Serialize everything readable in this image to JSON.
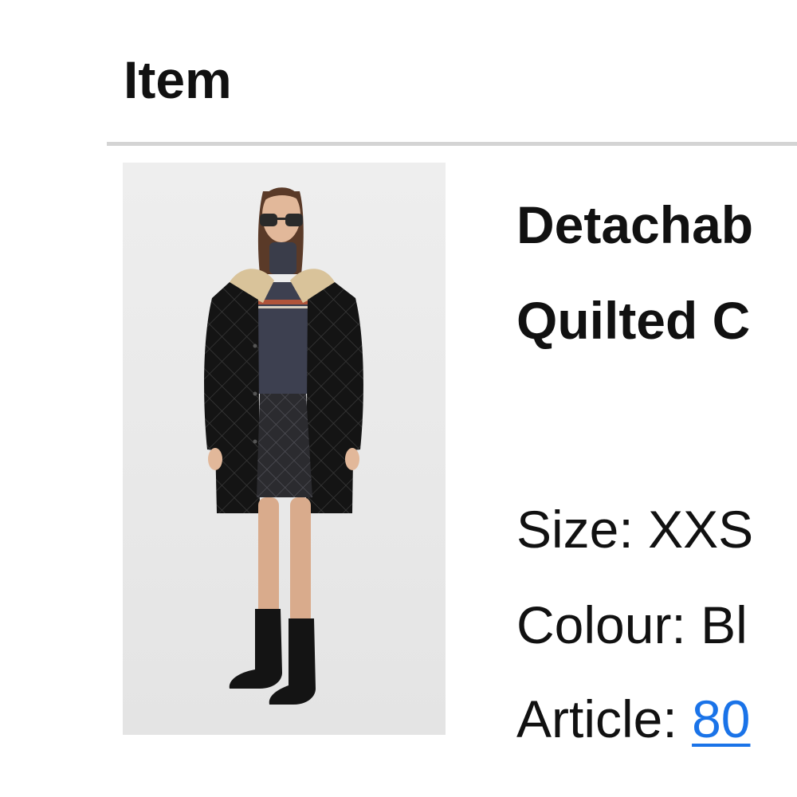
{
  "section": {
    "title": "Item"
  },
  "product": {
    "name_line1": "Detachab",
    "name_line2": "Quilted C",
    "image_alt": "Model wearing black quilted coat with beige collar",
    "details": {
      "size_label": "Size:",
      "size_value": "XXS",
      "colour_label": "Colour:",
      "colour_value": "Bl",
      "article_label": "Article:",
      "article_value": "80"
    }
  },
  "colors": {
    "link": "#1a73e8",
    "divider": "#d4d4d4",
    "text": "#111111"
  }
}
